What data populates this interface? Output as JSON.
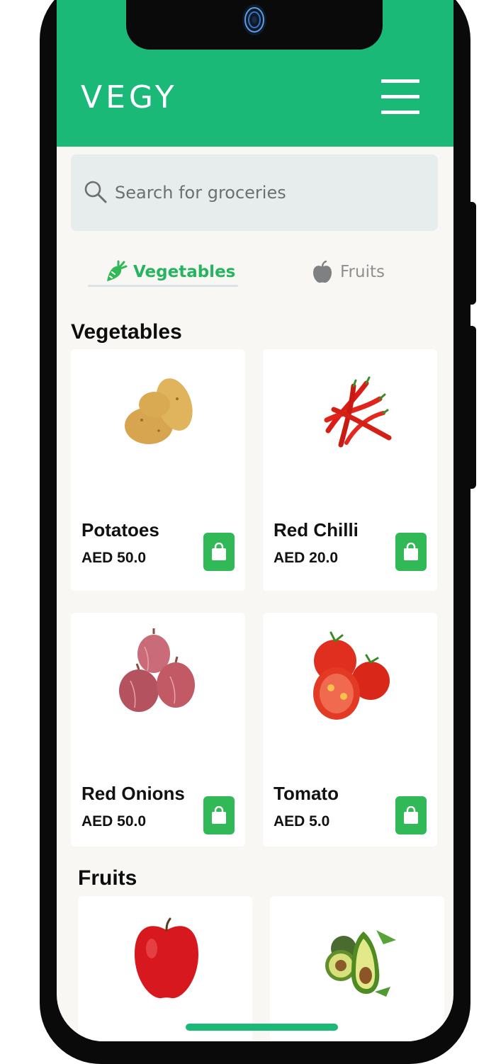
{
  "header": {
    "brand": "VEGY",
    "menu_icon": "hamburger-menu-icon",
    "background_color": "#1ab977"
  },
  "search": {
    "placeholder": "Search for groceries",
    "value": "",
    "icon": "search-icon"
  },
  "tabs": [
    {
      "label": "Vegetables",
      "icon": "carrot-icon",
      "active": true,
      "color": "#27b45f"
    },
    {
      "label": "Fruits",
      "icon": "apple-icon",
      "active": false,
      "color": "#8d8f90"
    }
  ],
  "sections": [
    {
      "title": "Vegetables",
      "products": [
        {
          "name": "Potatoes",
          "price": "AED 50.0",
          "image": "potatoes"
        },
        {
          "name": "Red Chilli",
          "price": "AED 20.0",
          "image": "red-chilli"
        },
        {
          "name": "Red Onions",
          "price": "AED 50.0",
          "image": "red-onions"
        },
        {
          "name": "Tomato",
          "price": "AED 5.0",
          "image": "tomato"
        }
      ]
    },
    {
      "title": "Fruits",
      "products": [
        {
          "image": "apple"
        },
        {
          "image": "avocado"
        }
      ]
    }
  ],
  "cart_button": {
    "icon": "shopping-bag-icon",
    "color": "#31b857"
  }
}
